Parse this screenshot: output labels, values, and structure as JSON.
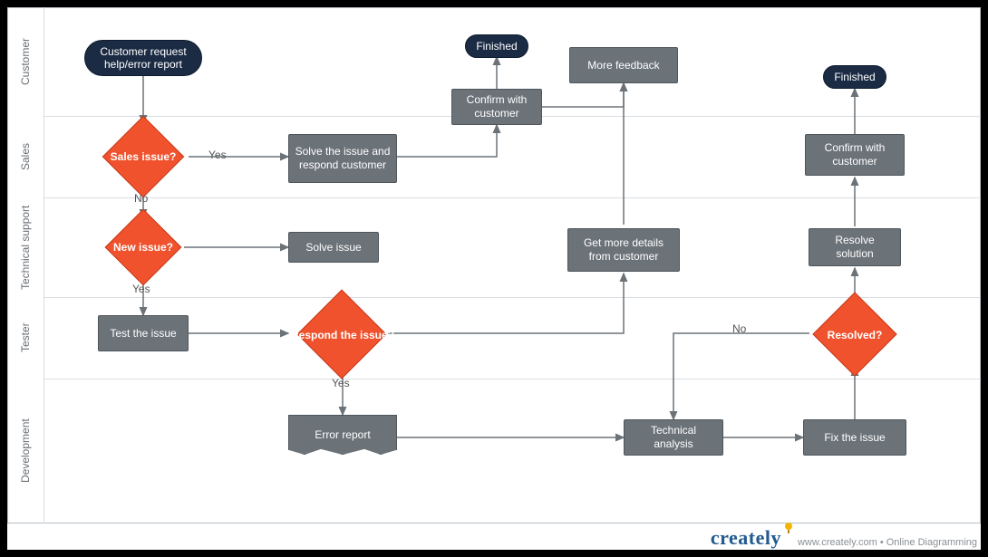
{
  "lanes": {
    "customer": "Customer",
    "sales": "Sales",
    "tech_support": "Technical support",
    "tester": "Tester",
    "development": "Development"
  },
  "nodes": {
    "start": "Customer request help/error report",
    "sales_issue": "Sales issue?",
    "solve_respond": "Solve the issue and respond customer",
    "confirm1": "Confirm with customer",
    "finished1": "Finished",
    "new_issue": "New issue?",
    "solve_issue": "Solve issue",
    "test_issue": "Test the issue",
    "respond_issue": "Respond the issue?",
    "error_report": "Error report",
    "technical_analysis": "Technical analysis",
    "get_more": "Get more details from customer",
    "more_feedback": "More feedback",
    "fix_issue": "Fix the issue",
    "resolved": "Resolved?",
    "resolve_solution": "Resolve solution",
    "confirm2": "Confirm with customer",
    "finished2": "Finished"
  },
  "edge_labels": {
    "yes1": "Yes",
    "no1": "No",
    "yes2": "Yes",
    "yes3": "Yes",
    "no2": "No"
  },
  "footer": {
    "brand": "creately",
    "tagline": "www.creately.com • Online Diagramming"
  }
}
